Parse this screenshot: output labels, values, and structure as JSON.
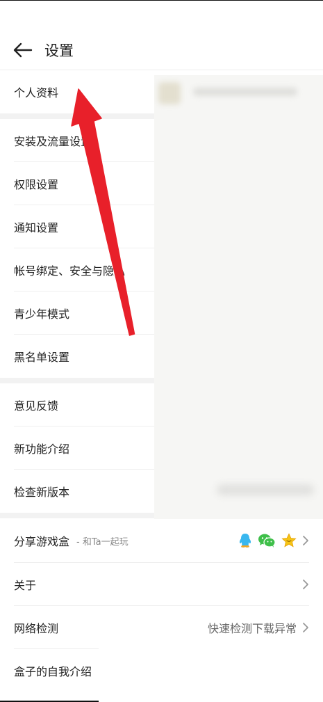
{
  "header": {
    "title": "设置"
  },
  "sections": {
    "profile": "个人资料",
    "install": "安装及流量设置",
    "permission": "权限设置",
    "notification": "通知设置",
    "account": "帐号绑定、安全与隐私",
    "youth": "青少年模式",
    "blacklist": "黑名单设置",
    "feedback": "意见反馈",
    "features": "新功能介绍",
    "update": "检查新版本",
    "share": "分享游戏盒",
    "share_sub": "- 和Ta一起玩",
    "about": "关于",
    "network": "网络检测",
    "network_value": "快速检测下载异常",
    "intro": "盒子的自我介绍"
  },
  "icons": {
    "back": "arrow-left-icon",
    "qq": "qq-icon",
    "wechat": "wechat-icon",
    "favorite": "star-icon",
    "chevron": "chevron-right-icon"
  },
  "colors": {
    "annotation_arrow": "#e8202a",
    "qq": "#39b7ef",
    "wechat": "#3fbf4a",
    "star": "#f6c515"
  }
}
